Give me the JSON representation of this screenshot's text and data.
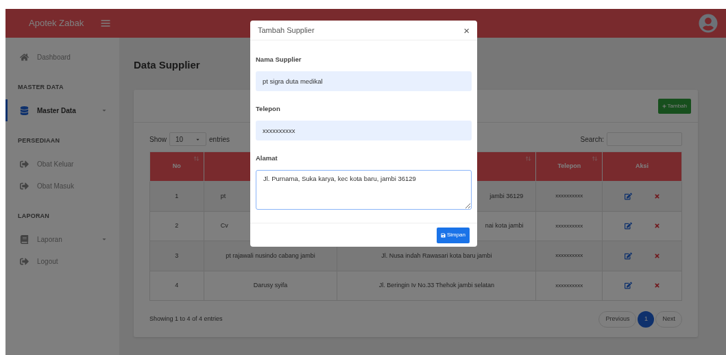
{
  "brand": "Apotek Zabak",
  "sidebar": {
    "items": [
      {
        "kind": "link",
        "label": "Dashboard",
        "selected": false,
        "dropdown": false
      },
      {
        "kind": "heading",
        "label": "MASTER DATA"
      },
      {
        "kind": "link",
        "label": "Master Data",
        "selected": true,
        "dropdown": true
      },
      {
        "kind": "heading",
        "label": "PERSEDIAAN"
      },
      {
        "kind": "link",
        "label": "Obat Keluar",
        "selected": false,
        "dropdown": false
      },
      {
        "kind": "link",
        "label": "Obat Masuk",
        "selected": false,
        "dropdown": false
      },
      {
        "kind": "heading",
        "label": "LAPORAN"
      },
      {
        "kind": "link",
        "label": "Laporan",
        "selected": false,
        "dropdown": true
      },
      {
        "kind": "link",
        "label": "Logout",
        "selected": false,
        "dropdown": false
      }
    ]
  },
  "page_title": "Data Supplier",
  "add_button": "Tambah",
  "length_control": {
    "before": "Show",
    "value": "10",
    "after": "entries"
  },
  "search": {
    "label": "Search:"
  },
  "table": {
    "columns": [
      {
        "label": "No",
        "sortable": true
      },
      {},
      {
        "sortable": true
      },
      {
        "label": "Telepon",
        "sortable": true
      },
      {
        "label": "Aksi",
        "sortable": false
      }
    ],
    "rows": [
      {
        "no": "1",
        "name": "pt",
        "address": "jambi 36129",
        "phone": "xxxxxxxxxx"
      },
      {
        "no": "2",
        "name": "Cv",
        "address": "nai kota jambi",
        "phone": "xxxxxxxxxx"
      },
      {
        "no": "3",
        "name": "pt rajawali nusindo cabang jambi",
        "address": "Jl. Nusa indah Rawasari kota baru jambi",
        "phone": "xxxxxxxxxx"
      },
      {
        "no": "4",
        "name": "Darusy syifa",
        "address": "Jl. Beringin Iv No.33 Thehok jambi selatan",
        "phone": "xxxxxxxxxx"
      }
    ]
  },
  "info": "Showing 1 to 4 of 4 entries",
  "pagination": [
    {
      "label": "Previous",
      "selected": false
    },
    {
      "label": "1",
      "selected": true
    },
    {
      "label": "Next",
      "selected": false
    }
  ],
  "modal": {
    "title": "Tambah Supplier",
    "close": "×",
    "fields": [
      {
        "kind": "input",
        "label": "Nama Supplier",
        "value": "pt sigra duta medikal"
      },
      {
        "kind": "input",
        "label": "Telepon",
        "value": "xxxxxxxxxx"
      },
      {
        "kind": "textarea",
        "label": "Alamat",
        "value": "Jl. Purnama, Suka karya, kec kota baru, jambi 36129"
      }
    ],
    "save_button": "Simpan"
  }
}
